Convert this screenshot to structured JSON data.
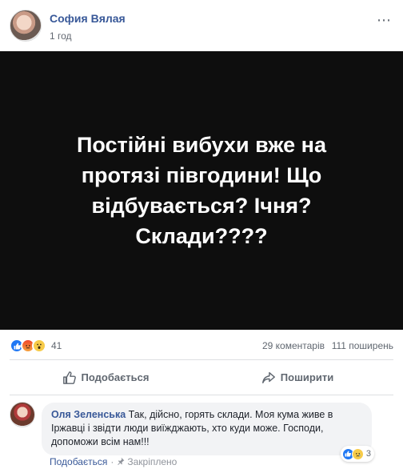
{
  "post": {
    "author": "София Вялая",
    "time": "1 год",
    "more_icon": "⋯",
    "text": "Постійні вибухи вже на протязі півгодини! Що відбувається? Ічня? Склади????",
    "image_bg": "#0e0e0e"
  },
  "reactions": {
    "icons": [
      "like-icon",
      "angry-icon",
      "wow-icon"
    ],
    "count": "41",
    "comments": "29 коментарів",
    "shares": "111 поширень"
  },
  "actions": {
    "like_label": "Подобається",
    "share_label": "Поширити"
  },
  "comment": {
    "author": "Оля Зеленська",
    "text": "Так, дійсно, горять склади. Моя кума живе в Іржавці і звідти люди виїжджають, хто куди може. Господи, допоможи всім нам!!!",
    "reaction_count": "3",
    "like_label": "Подобається",
    "separator": "·",
    "pinned_label": "Закріплено"
  },
  "colors": {
    "link_blue": "#385898",
    "secondary_gray": "#606770",
    "like_blue": "#2078f4"
  }
}
